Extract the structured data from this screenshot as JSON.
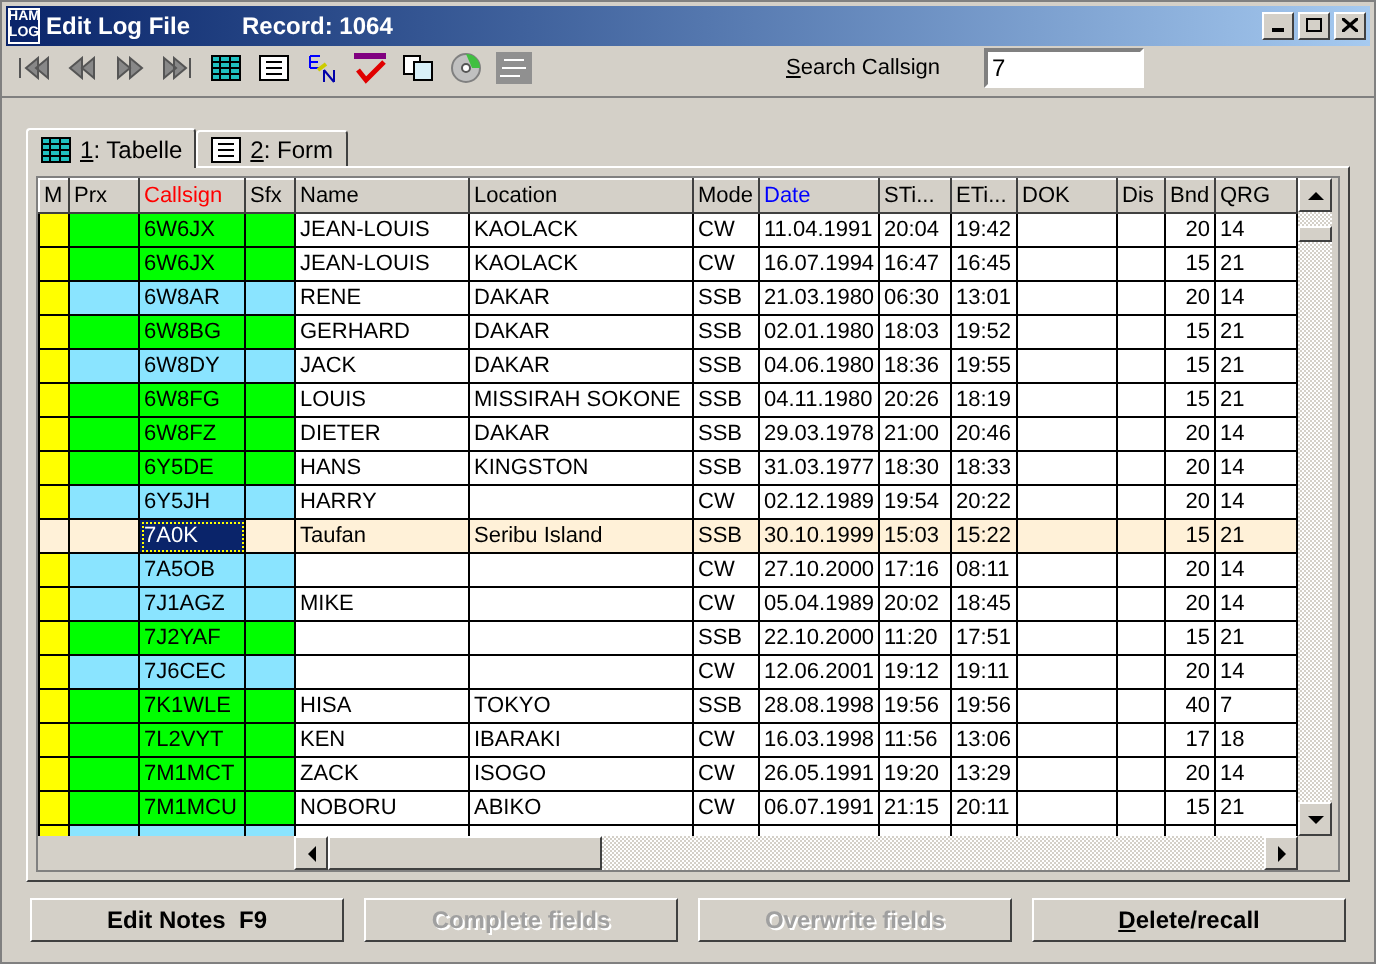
{
  "window": {
    "logo": [
      "HAM",
      "LOG"
    ],
    "title": "Edit Log File",
    "record": "Record: 1064"
  },
  "search": {
    "accel": "S",
    "label": "earch Callsign",
    "value": "7"
  },
  "tabs": [
    {
      "accel": "1",
      "label": ": Tabelle",
      "selected": true
    },
    {
      "accel": "2",
      "label": ": Form",
      "selected": false
    }
  ],
  "table": {
    "columns": [
      {
        "label": "M",
        "color": "#000000"
      },
      {
        "label": "Prx",
        "color": "#000000"
      },
      {
        "label": "Callsign",
        "color": "#ff0000"
      },
      {
        "label": "Sfx",
        "color": "#000000"
      },
      {
        "label": "Name",
        "color": "#000000"
      },
      {
        "label": "Location",
        "color": "#000000"
      },
      {
        "label": "Mode",
        "color": "#000000"
      },
      {
        "label": "Date",
        "color": "#0000ff"
      },
      {
        "label": "STi...",
        "color": "#000000"
      },
      {
        "label": "ETi...",
        "color": "#000000"
      },
      {
        "label": "DOK",
        "color": "#000000"
      },
      {
        "label": "Dis",
        "color": "#000000"
      },
      {
        "label": "Bnd",
        "color": "#000000"
      },
      {
        "label": "QRG",
        "color": "#000000"
      }
    ],
    "rows": [
      {
        "color": "#00ff00",
        "selected": false,
        "cells": [
          "",
          "",
          "6W6JX",
          "",
          "JEAN-LOUIS",
          "KAOLACK",
          "CW",
          "11.04.1991",
          "20:04",
          "19:42",
          "",
          "",
          "20",
          "14"
        ]
      },
      {
        "color": "#00ff00",
        "selected": false,
        "cells": [
          "",
          "",
          "6W6JX",
          "",
          "JEAN-LOUIS",
          "KAOLACK",
          "CW",
          "16.07.1994",
          "16:47",
          "16:45",
          "",
          "",
          "15",
          "21"
        ]
      },
      {
        "color": "#8ae4ff",
        "selected": false,
        "cells": [
          "",
          "",
          "6W8AR",
          "",
          "RENE",
          "DAKAR",
          "SSB",
          "21.03.1980",
          "06:30",
          "13:01",
          "",
          "",
          "20",
          "14"
        ]
      },
      {
        "color": "#00ff00",
        "selected": false,
        "cells": [
          "",
          "",
          "6W8BG",
          "",
          "GERHARD",
          "DAKAR",
          "SSB",
          "02.01.1980",
          "18:03",
          "19:52",
          "",
          "",
          "15",
          "21"
        ]
      },
      {
        "color": "#8ae4ff",
        "selected": false,
        "cells": [
          "",
          "",
          "6W8DY",
          "",
          "JACK",
          "DAKAR",
          "SSB",
          "04.06.1980",
          "18:36",
          "19:55",
          "",
          "",
          "15",
          "21"
        ]
      },
      {
        "color": "#00ff00",
        "selected": false,
        "cells": [
          "",
          "",
          "6W8FG",
          "",
          "LOUIS",
          "MISSIRAH SOKONE",
          "SSB",
          "04.11.1980",
          "20:26",
          "18:19",
          "",
          "",
          "15",
          "21"
        ]
      },
      {
        "color": "#00ff00",
        "selected": false,
        "cells": [
          "",
          "",
          "6W8FZ",
          "",
          "DIETER",
          "DAKAR",
          "SSB",
          "29.03.1978",
          "21:00",
          "20:46",
          "",
          "",
          "20",
          "14"
        ]
      },
      {
        "color": "#00ff00",
        "selected": false,
        "cells": [
          "",
          "",
          "6Y5DE",
          "",
          "HANS",
          "KINGSTON",
          "SSB",
          "31.03.1977",
          "18:30",
          "18:33",
          "",
          "",
          "20",
          "14"
        ]
      },
      {
        "color": "#8ae4ff",
        "selected": false,
        "cells": [
          "",
          "",
          "6Y5JH",
          "",
          "HARRY",
          "",
          "CW",
          "02.12.1989",
          "19:54",
          "20:22",
          "",
          "",
          "20",
          "14"
        ]
      },
      {
        "color": "#fff1d8",
        "selected": true,
        "cells": [
          "",
          "",
          "7A0K",
          "",
          "Taufan",
          "Seribu Island",
          "SSB",
          "30.10.1999",
          "15:03",
          "15:22",
          "",
          "",
          "15",
          "21"
        ]
      },
      {
        "color": "#8ae4ff",
        "selected": false,
        "cells": [
          "",
          "",
          "7A5OB",
          "",
          "",
          "",
          "CW",
          "27.10.2000",
          "17:16",
          "08:11",
          "",
          "",
          "20",
          "14"
        ]
      },
      {
        "color": "#8ae4ff",
        "selected": false,
        "cells": [
          "",
          "",
          "7J1AGZ",
          "",
          "MIKE",
          "",
          "CW",
          "05.04.1989",
          "20:02",
          "18:45",
          "",
          "",
          "20",
          "14"
        ]
      },
      {
        "color": "#00ff00",
        "selected": false,
        "cells": [
          "",
          "",
          "7J2YAF",
          "",
          "",
          "",
          "SSB",
          "22.10.2000",
          "11:20",
          "17:51",
          "",
          "",
          "15",
          "21"
        ]
      },
      {
        "color": "#8ae4ff",
        "selected": false,
        "cells": [
          "",
          "",
          "7J6CEC",
          "",
          "",
          "",
          "CW",
          "12.06.2001",
          "19:12",
          "19:11",
          "",
          "",
          "20",
          "14"
        ]
      },
      {
        "color": "#00ff00",
        "selected": false,
        "cells": [
          "",
          "",
          "7K1WLE",
          "",
          "HISA",
          "TOKYO",
          "SSB",
          "28.08.1998",
          "19:56",
          "19:56",
          "",
          "",
          "40",
          "7"
        ]
      },
      {
        "color": "#00ff00",
        "selected": false,
        "cells": [
          "",
          "",
          "7L2VYT",
          "",
          "KEN",
          "IBARAKI",
          "CW",
          "16.03.1998",
          "11:56",
          "13:06",
          "",
          "",
          "17",
          "18"
        ]
      },
      {
        "color": "#00ff00",
        "selected": false,
        "cells": [
          "",
          "",
          "7M1MCT",
          "",
          "ZACK",
          "ISOGO",
          "CW",
          "26.05.1991",
          "19:20",
          "13:29",
          "",
          "",
          "20",
          "14"
        ]
      },
      {
        "color": "#00ff00",
        "selected": false,
        "cells": [
          "",
          "",
          "7M1MCU",
          "",
          "NOBORU",
          "ABIKO",
          "CW",
          "06.07.1991",
          "21:15",
          "20:11",
          "",
          "",
          "15",
          "21"
        ]
      },
      {
        "color": "#8ae4ff",
        "selected": false,
        "cells": [
          "",
          "",
          "",
          "",
          "",
          "",
          "",
          "",
          "",
          "",
          "",
          "",
          "",
          ""
        ]
      }
    ]
  },
  "buttons": [
    {
      "label": "Edit Notes  F9",
      "disabled": false
    },
    {
      "label": "Complete fields",
      "disabled": true
    },
    {
      "label": "Overwrite fields",
      "disabled": true
    },
    {
      "accel": "D",
      "label": "elete/recall",
      "disabled": false
    }
  ]
}
